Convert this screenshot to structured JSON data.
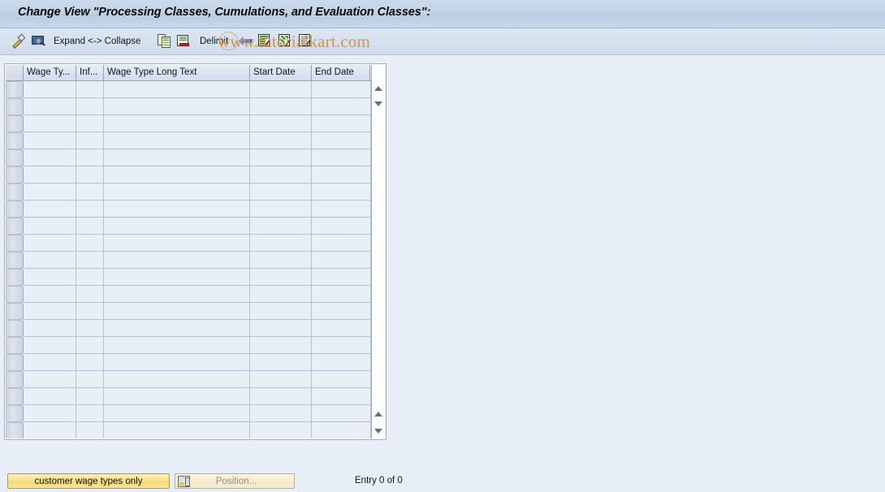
{
  "window": {
    "title": "Change View \"Processing Classes, Cumulations, and Evaluation Classes\":"
  },
  "toolbar": {
    "items": [
      {
        "name": "change-pencil",
        "icon": "pencil-icon",
        "label": ""
      },
      {
        "name": "display-magnifier",
        "icon": "display-magnifier-icon",
        "label": ""
      },
      {
        "name": "expand-collapse",
        "icon": "",
        "label": "Expand <-> Collapse"
      },
      {
        "name": "copy-as",
        "icon": "copy-icon",
        "label": ""
      },
      {
        "name": "delete-delimited",
        "icon": "delete-row-icon",
        "label": ""
      },
      {
        "name": "delimit",
        "icon": "",
        "label": "Delimit"
      },
      {
        "name": "undo-change",
        "icon": "undo-arrow-icon",
        "label": ""
      },
      {
        "name": "select-all-entries",
        "icon": "select-list-icon",
        "label": ""
      },
      {
        "name": "deselect-all-entries",
        "icon": "deselect-list-icon",
        "label": ""
      },
      {
        "name": "select-block",
        "icon": "select-block-icon",
        "label": ""
      }
    ]
  },
  "watermark": {
    "text": "www.tutorialkart.com"
  },
  "table": {
    "columns": [
      {
        "key": "select",
        "label": "",
        "width_class": "w-sel"
      },
      {
        "key": "wage_type",
        "label": "Wage Ty...",
        "width_class": "w-wt"
      },
      {
        "key": "infotype",
        "label": "Inf...",
        "width_class": "w-inf"
      },
      {
        "key": "long_text",
        "label": "Wage Type Long Text",
        "width_class": "w-long"
      },
      {
        "key": "start_date",
        "label": "Start Date",
        "width_class": "w-sd"
      },
      {
        "key": "end_date",
        "label": "End Date",
        "width_class": "w-ed"
      }
    ],
    "row_count": 21,
    "rows": [],
    "config_icon": "table-settings-icon",
    "scroll": {
      "top_up": "scroll-up-icon",
      "top_down": "scroll-down-icon",
      "bottom_up": "scroll-page-up-icon",
      "bottom_down": "scroll-page-down-icon"
    }
  },
  "footer": {
    "customer_button_label": "customer wage types only",
    "position_button_label": "Position...",
    "position_icon": "position-icon",
    "entry_status": "Entry 0 of 0"
  },
  "colors": {
    "background": "#e8eef7",
    "title_bar": "#c3d3e7",
    "grid_cell": "#e9eff7",
    "grid_line": "#b3c2d6",
    "accent_yellow": "#f6d873",
    "watermark": "#d98b33"
  }
}
